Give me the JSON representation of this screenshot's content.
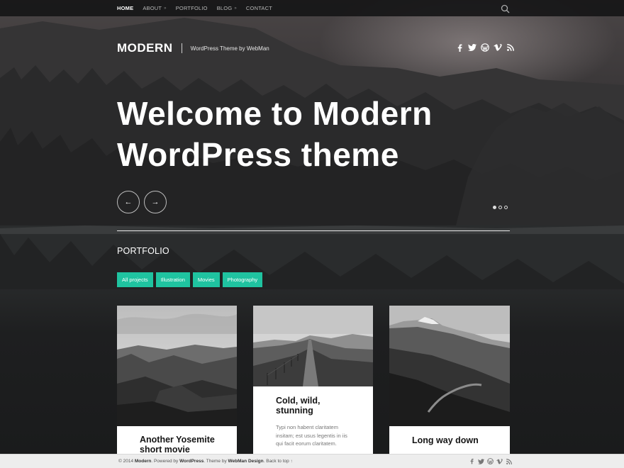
{
  "nav": {
    "items": [
      {
        "label": "HOME",
        "active": true,
        "has_submenu": false
      },
      {
        "label": "ABOUT",
        "active": false,
        "has_submenu": true
      },
      {
        "label": "PORTFOLIO",
        "active": false,
        "has_submenu": false
      },
      {
        "label": "BLOG",
        "active": false,
        "has_submenu": true
      },
      {
        "label": "CONTACT",
        "active": false,
        "has_submenu": false
      }
    ],
    "submenu_indicator": "»",
    "search_icon": "search-icon"
  },
  "header": {
    "site_title": "MODERN",
    "tagline": "WordPress Theme by WebMan",
    "social_icons": [
      "facebook-icon",
      "twitter-icon",
      "wordpress-icon",
      "vimeo-icon",
      "rss-icon"
    ]
  },
  "hero": {
    "title_line1": "Welcome to Modern",
    "title_line2": "WordPress theme",
    "prev_icon": "←",
    "next_icon": "→",
    "slides_total": 3,
    "active_slide": 1
  },
  "portfolio": {
    "heading": "PORTFOLIO",
    "filters": [
      "All projects",
      "Illustration",
      "Movies",
      "Photography"
    ],
    "items": [
      {
        "title_line1": "Another Yosemite",
        "title_line2": "short movie",
        "excerpt": ""
      },
      {
        "title_line1": "Cold, wild,",
        "title_line2": "stunning",
        "excerpt": "Typi non habent claritatem insitam; est usus legentis in iis qui facit eorum claritatem."
      },
      {
        "title_line1": "Long way down",
        "title_line2": "",
        "excerpt": ""
      }
    ]
  },
  "footer": {
    "copyright_prefix": "© 2014",
    "site_name": "Modern",
    "powered_text": ". Powered by",
    "platform": "WordPress",
    "theme_text": ". Theme by",
    "author": "WebMan Design",
    "back_to_top": ". Back to top ↑",
    "social_icons": [
      "facebook-icon",
      "twitter-icon",
      "wordpress-icon",
      "vimeo-icon",
      "rss-icon"
    ]
  },
  "colors": {
    "accent": "#1fc3a0",
    "nav_bg": "#161617",
    "footer_bg": "#ededed"
  }
}
